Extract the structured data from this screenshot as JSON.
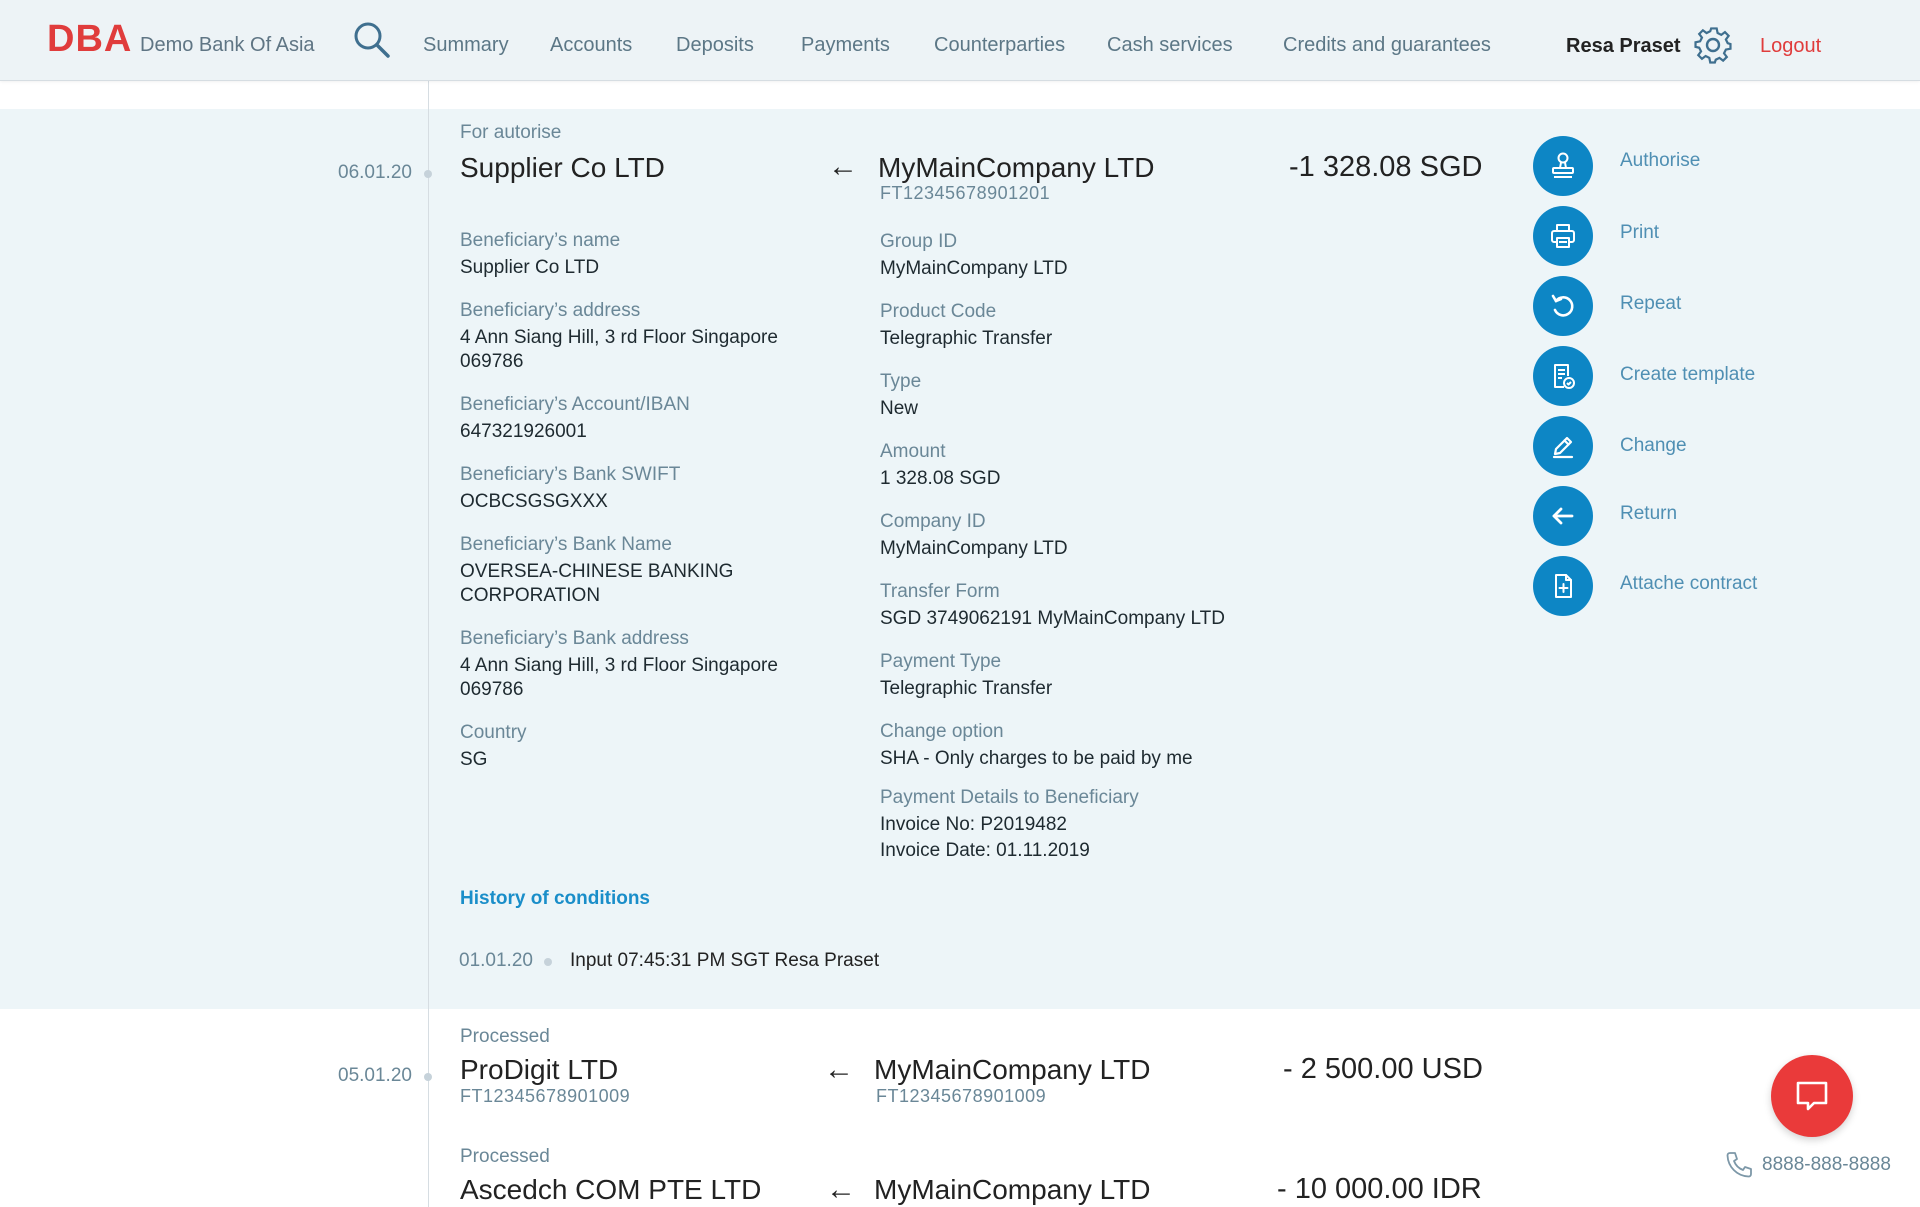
{
  "header": {
    "logo": "DBA",
    "bank_name": "Demo Bank Of Asia",
    "nav": [
      "Summary",
      "Accounts",
      "Deposits",
      "Payments",
      "Counterparties",
      "Cash services",
      "Credits and guarantees"
    ],
    "user": "Resa Praset",
    "logout": "Logout"
  },
  "selected": {
    "date": "06.01.20",
    "status": "For autorise",
    "beneficiary": "Supplier Co LTD",
    "payer": "MyMainCompany LTD",
    "payer_ref": "FT12345678901201",
    "amount": "-1 328.08 SGD",
    "left_fields": [
      {
        "label": "Beneficiary’s name",
        "value": "Supplier Co LTD"
      },
      {
        "label": "Beneficiary’s address",
        "value": "4 Ann Siang Hill, 3 rd Floor Singapore 069786"
      },
      {
        "label": "Beneficiary’s Account/IBAN",
        "value": "647321926001"
      },
      {
        "label": "Beneficiary’s Bank SWIFT",
        "value": "OCBCSGSGXXX"
      },
      {
        "label": "Beneficiary’s Bank Name",
        "value": "OVERSEA-CHINESE BANKING CORPORATION"
      },
      {
        "label": "Beneficiary’s Bank address",
        "value": "4 Ann Siang Hill, 3 rd Floor Singapore 069786"
      },
      {
        "label": "Country",
        "value": "SG"
      }
    ],
    "right_fields": [
      {
        "label": "Group ID",
        "value": "MyMainCompany LTD"
      },
      {
        "label": "Product Code",
        "value": "Telegraphic Transfer"
      },
      {
        "label": "Type",
        "value": "New"
      },
      {
        "label": "Amount",
        "value": "1 328.08 SGD"
      },
      {
        "label": "Company ID",
        "value": "MyMainCompany LTD"
      },
      {
        "label": "Transfer Form",
        "value": "SGD 3749062191 MyMainCompany LTD"
      },
      {
        "label": "Payment Type",
        "value": "Telegraphic Transfer"
      },
      {
        "label": "Change option",
        "value": "SHA - Only charges to be paid by me"
      },
      {
        "label": "Payment Details to Beneficiary",
        "value": "Invoice No: P2019482",
        "value2": "Invoice Date: 01.11.2019"
      }
    ],
    "history_title": "History of conditions",
    "history": [
      {
        "date": "01.01.20",
        "text": "Input  07:45:31 PM SGT Resa Praset"
      }
    ]
  },
  "actions": [
    {
      "label": "Authorise",
      "icon": "stamp-icon"
    },
    {
      "label": "Print",
      "icon": "printer-icon"
    },
    {
      "label": "Repeat",
      "icon": "repeat-icon"
    },
    {
      "label": "Create template",
      "icon": "template-icon"
    },
    {
      "label": "Change",
      "icon": "pencil-icon"
    },
    {
      "label": "Return",
      "icon": "arrow-left-icon"
    },
    {
      "label": "Attache contract",
      "icon": "file-plus-icon"
    }
  ],
  "transactions": [
    {
      "date": "05.01.20",
      "status": "Processed",
      "beneficiary": "ProDigit LTD",
      "beneficiary_ref": "FT12345678901009",
      "payer": "MyMainCompany LTD",
      "payer_ref": "FT12345678901009",
      "amount": "- 2 500.00 USD"
    },
    {
      "date": "",
      "status": "Processed",
      "beneficiary": "Ascedch COM PTE LTD",
      "beneficiary_ref": "",
      "payer": "MyMainCompany LTD",
      "payer_ref": "",
      "amount": "- 10 000.00 IDR"
    }
  ],
  "arrow_symbol": "←",
  "support_phone": "8888-888-8888",
  "colors": {
    "brand": "#e03c3c",
    "accent": "#0d86c5",
    "panel": "#edf5f8"
  }
}
